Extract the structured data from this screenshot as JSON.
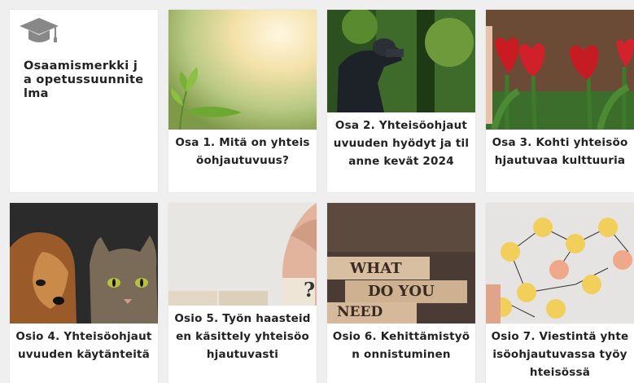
{
  "cards": [
    {
      "title": "Osaamismerkki ja opetussuunnitelma",
      "icon": "graduation-cap-icon"
    },
    {
      "title": "Osa 1. Mitä on yhteisöohjautuvuus?"
    },
    {
      "title": "Osa 2. Yhteisöohjautuvuuden hyödyt ja tilanne kevät 2024"
    },
    {
      "title": "Osa 3. Kohti yhteisöohjautuvaa kulttuuria"
    },
    {
      "title": "Osio 4. Yhteisöohjautuvuuden käytänteitä"
    },
    {
      "title": "Osio 5. Työn haasteiden käsittely yhteisöohjautuvasti"
    },
    {
      "title": "Osio 6. Kehittämistyön onnistuminen"
    },
    {
      "title": "Osio 7. Viestintä yhteisöohjautuvassa työyhteisössä"
    }
  ],
  "blocks_image": {
    "line1": "WHAT",
    "line2": "DO YOU",
    "line3": "NEED"
  },
  "colors": {
    "card_bg": "#ffffff",
    "page_bg": "#efefef",
    "text": "#222222",
    "icon": "#888888"
  }
}
